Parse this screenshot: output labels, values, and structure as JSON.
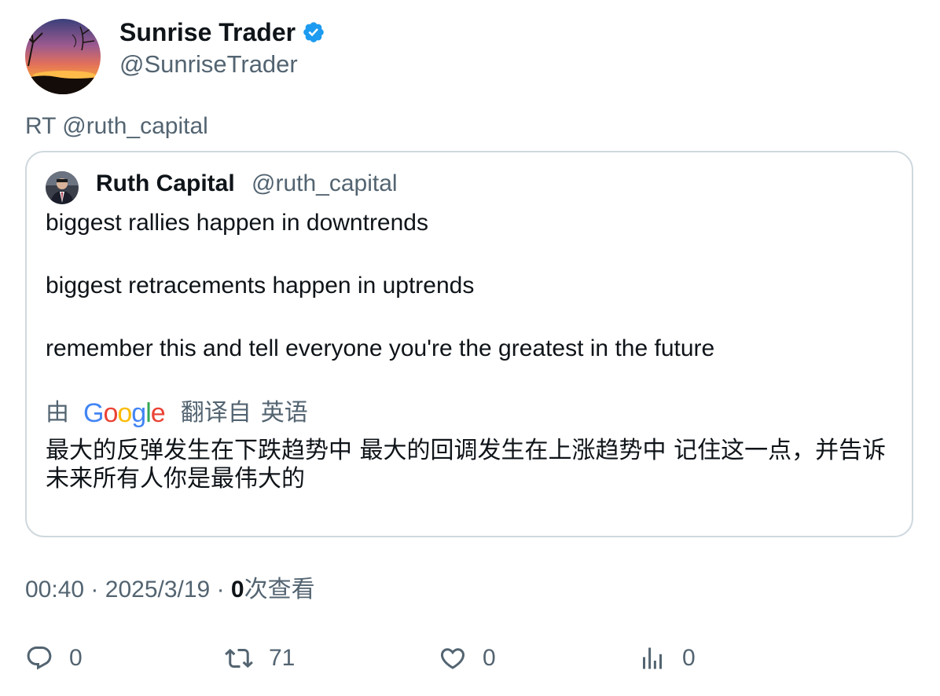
{
  "tweet": {
    "author_name": "Sunrise Trader",
    "author_handle": "@SunriseTrader",
    "verified": true,
    "retweet_text": "RT @ruth_capital",
    "time": "00:40",
    "separator": "·",
    "date": "2025/3/19",
    "views_count": "0",
    "views_label": "次查看"
  },
  "quote": {
    "author_name": "Ruth Capital",
    "author_handle": "@ruth_capital",
    "lines": [
      "biggest rallies happen in downtrends",
      "biggest retracements happen in uptrends",
      "remember this and tell everyone you're the greatest in the future"
    ],
    "translation": {
      "by_label": "由",
      "provider": "Google",
      "from_label": "翻译自",
      "language": "英语",
      "text": "最大的反弹发生在下跌趋势中 最大的回调发生在上涨趋势中 记住这一点，并告诉未来所有人你是最伟大的"
    }
  },
  "actions": {
    "replies": "0",
    "retweets": "71",
    "likes": "0",
    "views": "0"
  },
  "colors": {
    "text_primary": "#0f1419",
    "text_secondary": "#536471",
    "verified_blue": "#1d9bf0",
    "border": "#cfd9de"
  }
}
